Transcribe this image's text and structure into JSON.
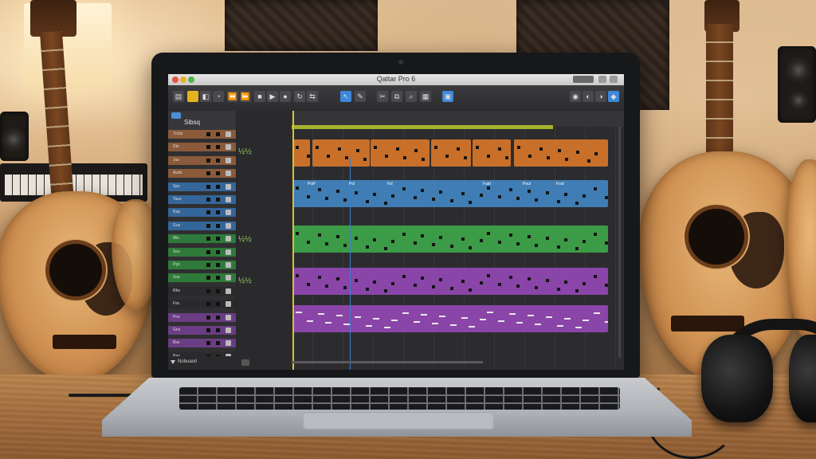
{
  "app": {
    "window_title": "Qaltar Pro 6",
    "track_panel_title": "Sibsq",
    "footer_label": "Nobuaorl"
  },
  "track_headers": [
    {
      "label": "Trcbs",
      "color": "#8a5a3a"
    },
    {
      "label": "Dts",
      "color": "#8a5a3a"
    },
    {
      "label": "Jus",
      "color": "#8a5a3a"
    },
    {
      "label": "Auds",
      "color": "#8a5a3a"
    },
    {
      "label": "Sps",
      "color": "#34669a"
    },
    {
      "label": "Taus",
      "color": "#34669a"
    },
    {
      "label": "Rap",
      "color": "#34669a"
    },
    {
      "label": "Gus",
      "color": "#34669a"
    },
    {
      "label": "Mis",
      "color": "#2f7a3a"
    },
    {
      "label": "Sos",
      "color": "#2f7a3a"
    },
    {
      "label": "Pgs",
      "color": "#2f7a3a"
    },
    {
      "label": "Sus",
      "color": "#2f7a3a"
    },
    {
      "label": "Rbs",
      "color": "#2a2a2c"
    },
    {
      "label": "Fss",
      "color": "#2a2a2c"
    },
    {
      "label": "Pns",
      "color": "#6a3d84"
    },
    {
      "label": "Gns",
      "color": "#6a3d84"
    },
    {
      "label": "Bss",
      "color": "#6a3d84"
    },
    {
      "label": "Ras",
      "color": "#2a2a2c"
    }
  ],
  "region_labels": [
    "PoiF",
    "Pol",
    "Fsl",
    "Faid",
    "Poul",
    "Fost"
  ],
  "mini_glyphs": [
    "½½",
    "½½",
    "½½"
  ],
  "colors": {
    "orange": "#c8702a",
    "blue": "#3f7db4",
    "green": "#3c9b46",
    "purple": "#8a45a8",
    "cycle": "#a5b22d",
    "playhead": "#d8c23a"
  }
}
